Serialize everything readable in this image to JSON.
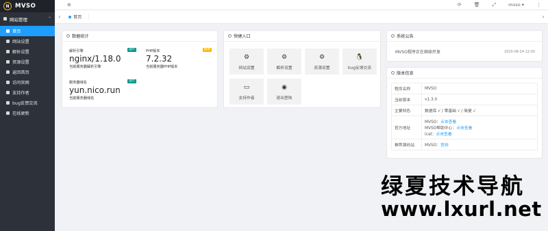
{
  "app": {
    "logo_letter": "N",
    "name": "MVSO"
  },
  "sidebar": {
    "group": "网站管理",
    "items": [
      {
        "label": "首页",
        "active": true
      },
      {
        "label": "网站设置"
      },
      {
        "label": "解析设置"
      },
      {
        "label": "资源设置"
      },
      {
        "label": "返回首页"
      },
      {
        "label": "访问官网"
      },
      {
        "label": "支持作者"
      },
      {
        "label": "bug反馈交流"
      },
      {
        "label": "在线更新"
      }
    ]
  },
  "topbar": {
    "menu_icon": "≡",
    "refresh_icon": "⟳",
    "trash_icon": "🗑",
    "fullscreen_icon": "⤢",
    "user": "mvso ▾",
    "more": "⋮"
  },
  "tabs": {
    "prev": "‹",
    "home": "首页",
    "next": "›"
  },
  "stats_card": {
    "title": "数据统计",
    "items": [
      {
        "label": "解析引擎",
        "value": "nginx/1.18.0",
        "desc": "当前服务器解析引擎",
        "badge": "运行"
      },
      {
        "label": "PHP版本",
        "value": "7.2.32",
        "desc": "当前服务器PHP版本",
        "badge": "版本"
      },
      {
        "label": "服务器域名",
        "value": "yun.nico.run",
        "desc": "当前服务器域名",
        "badge": "运行"
      }
    ]
  },
  "quick_card": {
    "title": "快捷入口",
    "items": [
      {
        "label": "网站设置",
        "icon": "⚙"
      },
      {
        "label": "解析设置",
        "icon": "⚙"
      },
      {
        "label": "资源设置",
        "icon": "⚙"
      },
      {
        "label": "bug反馈交流",
        "icon": "🐧"
      },
      {
        "label": "支持作者",
        "icon": "▭"
      },
      {
        "label": "退出登陆",
        "icon": "◉"
      }
    ]
  },
  "announce_card": {
    "title": "系统公告",
    "text": "MVSO程序正在继续开发",
    "date": "2020-08-24 12:00"
  },
  "version_card": {
    "title": "版本信息",
    "rows": [
      {
        "k": "程序名称",
        "v": "MVSO"
      },
      {
        "k": "当前版本",
        "v": "v1.3.0"
      },
      {
        "k": "主要特色",
        "v": "数据库 √ / 零基础 √ / 简便 √"
      },
      {
        "k": "官方地址",
        "lines": [
          {
            "prefix": "MVSO：",
            "link": "点击查看"
          },
          {
            "prefix": "MVSO帮助中心：",
            "link": "点击查看"
          },
          {
            "prefix": "lcat：",
            "link": "点击查看"
          }
        ]
      },
      {
        "k": "推荐源码站",
        "lines": [
          {
            "prefix": "MVSO：",
            "link": "官网"
          }
        ]
      }
    ]
  },
  "watermark": {
    "cn": "绿夏技术导航",
    "url": "www.lxurl.net"
  },
  "colors": {
    "accent": "#1e9fff",
    "sidebar": "#2c313a",
    "badge_green": "#009688",
    "badge_orange": "#ffb800"
  }
}
